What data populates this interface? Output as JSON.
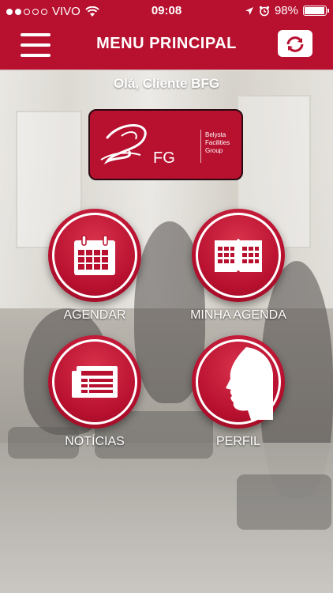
{
  "status_bar": {
    "carrier": "VIVO",
    "time": "09:08",
    "battery": "98%",
    "battery_level": 0.98,
    "icons": [
      "signal-dots-icon",
      "wifi-icon",
      "location-arrow-icon",
      "alarm-icon",
      "battery-icon"
    ]
  },
  "navbar": {
    "title": "MENU PRINCIPAL",
    "left_icon": "hamburger-menu-icon",
    "right_icon": "camera-switch-icon"
  },
  "greeting": "Olá, Cliente BFG",
  "logo": {
    "mark_text": "FG",
    "subtitle": [
      "Belysta",
      "Facilities",
      "Group"
    ]
  },
  "tiles": [
    {
      "label": "AGENDAR",
      "icon": "calendar-icon"
    },
    {
      "label": "MINHA AGENDA",
      "icon": "open-agenda-book-icon"
    },
    {
      "label": "NOTÍCIAS",
      "icon": "newspaper-icon"
    },
    {
      "label": "PERFIL",
      "icon": "face-profile-icon"
    }
  ],
  "colors": {
    "brand_red": "#b8102f",
    "white": "#ffffff"
  }
}
